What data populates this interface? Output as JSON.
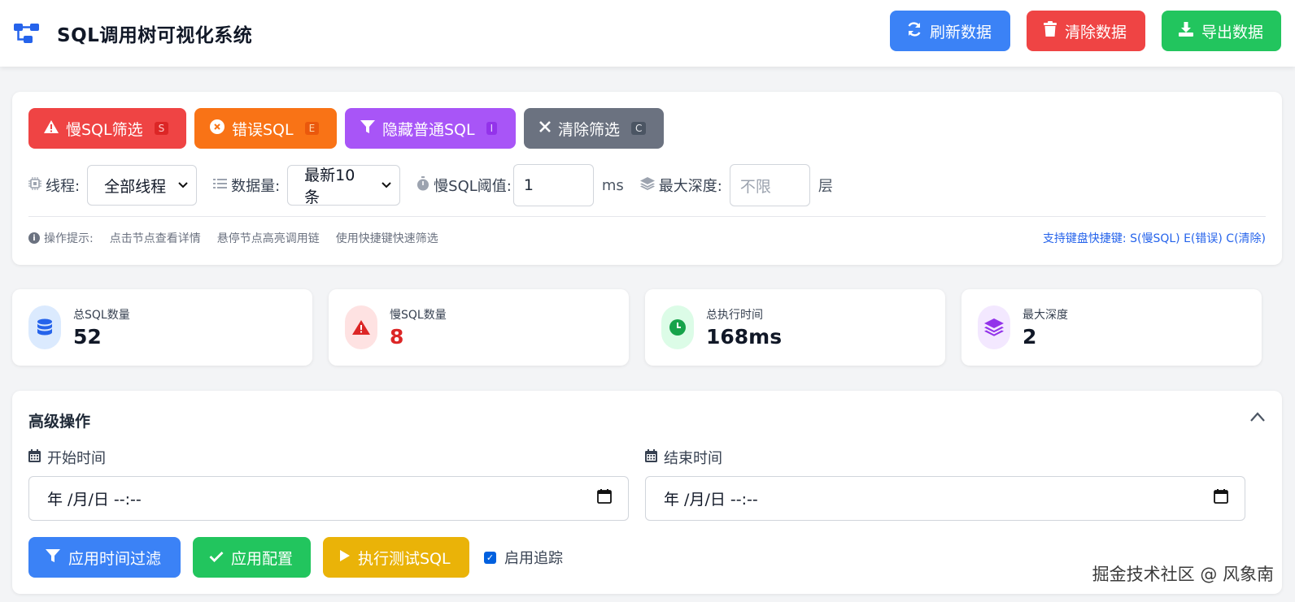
{
  "header": {
    "title": "SQL调用树可视化系统",
    "logo_icon": "sitemap-icon",
    "buttons": {
      "refresh": "刷新数据",
      "clear": "清除数据",
      "export": "导出数据"
    }
  },
  "filters": {
    "chips": {
      "slow": {
        "label": "慢SQL筛选",
        "key": "S"
      },
      "error": {
        "label": "错误SQL",
        "key": "E"
      },
      "hide": {
        "label": "隐藏普通SQL",
        "key": "I"
      },
      "clear": {
        "label": "清除筛选",
        "key": "C"
      }
    },
    "thread_label": "线程:",
    "thread_value": "全部线程",
    "data_label": "数据量:",
    "data_value": "最新10条",
    "threshold_label": "慢SQL阈值:",
    "threshold_value": "1",
    "threshold_unit": "ms",
    "depth_label": "最大深度:",
    "depth_placeholder": "不限",
    "depth_unit": "层",
    "hint_label": "操作提示:",
    "hints": [
      "点击节点查看详情",
      "悬停节点高亮调用链",
      "使用快捷键快速筛选"
    ],
    "shortcuts": "支持键盘快捷键: S(慢SQL) E(错误) C(清除)"
  },
  "stats": [
    {
      "label": "总SQL数量",
      "value": "52",
      "color": "#2563eb",
      "bg": "#dbeafe",
      "icon": "database-icon"
    },
    {
      "label": "慢SQL数量",
      "value": "8",
      "color": "#dc2626",
      "bg": "#fee2e2",
      "icon": "warning-icon"
    },
    {
      "label": "总执行时间",
      "value": "168ms",
      "color": "#16a34a",
      "bg": "#dcfce7",
      "icon": "clock-icon"
    },
    {
      "label": "最大深度",
      "value": "2",
      "color": "#9333ea",
      "bg": "#f3e8ff",
      "icon": "layers-icon"
    }
  ],
  "advanced": {
    "title": "高级操作",
    "start_label": "开始时间",
    "end_label": "结束时间",
    "start_value": "年 /月/日 --:--",
    "end_value": "年 /月/日 --:--",
    "buttons": {
      "time_filter": "应用时间过滤",
      "apply_config": "应用配置",
      "run_test": "执行测试SQL"
    },
    "tracking_label": "启用追踪"
  },
  "watermark": "掘金技术社区 @ 风象南"
}
